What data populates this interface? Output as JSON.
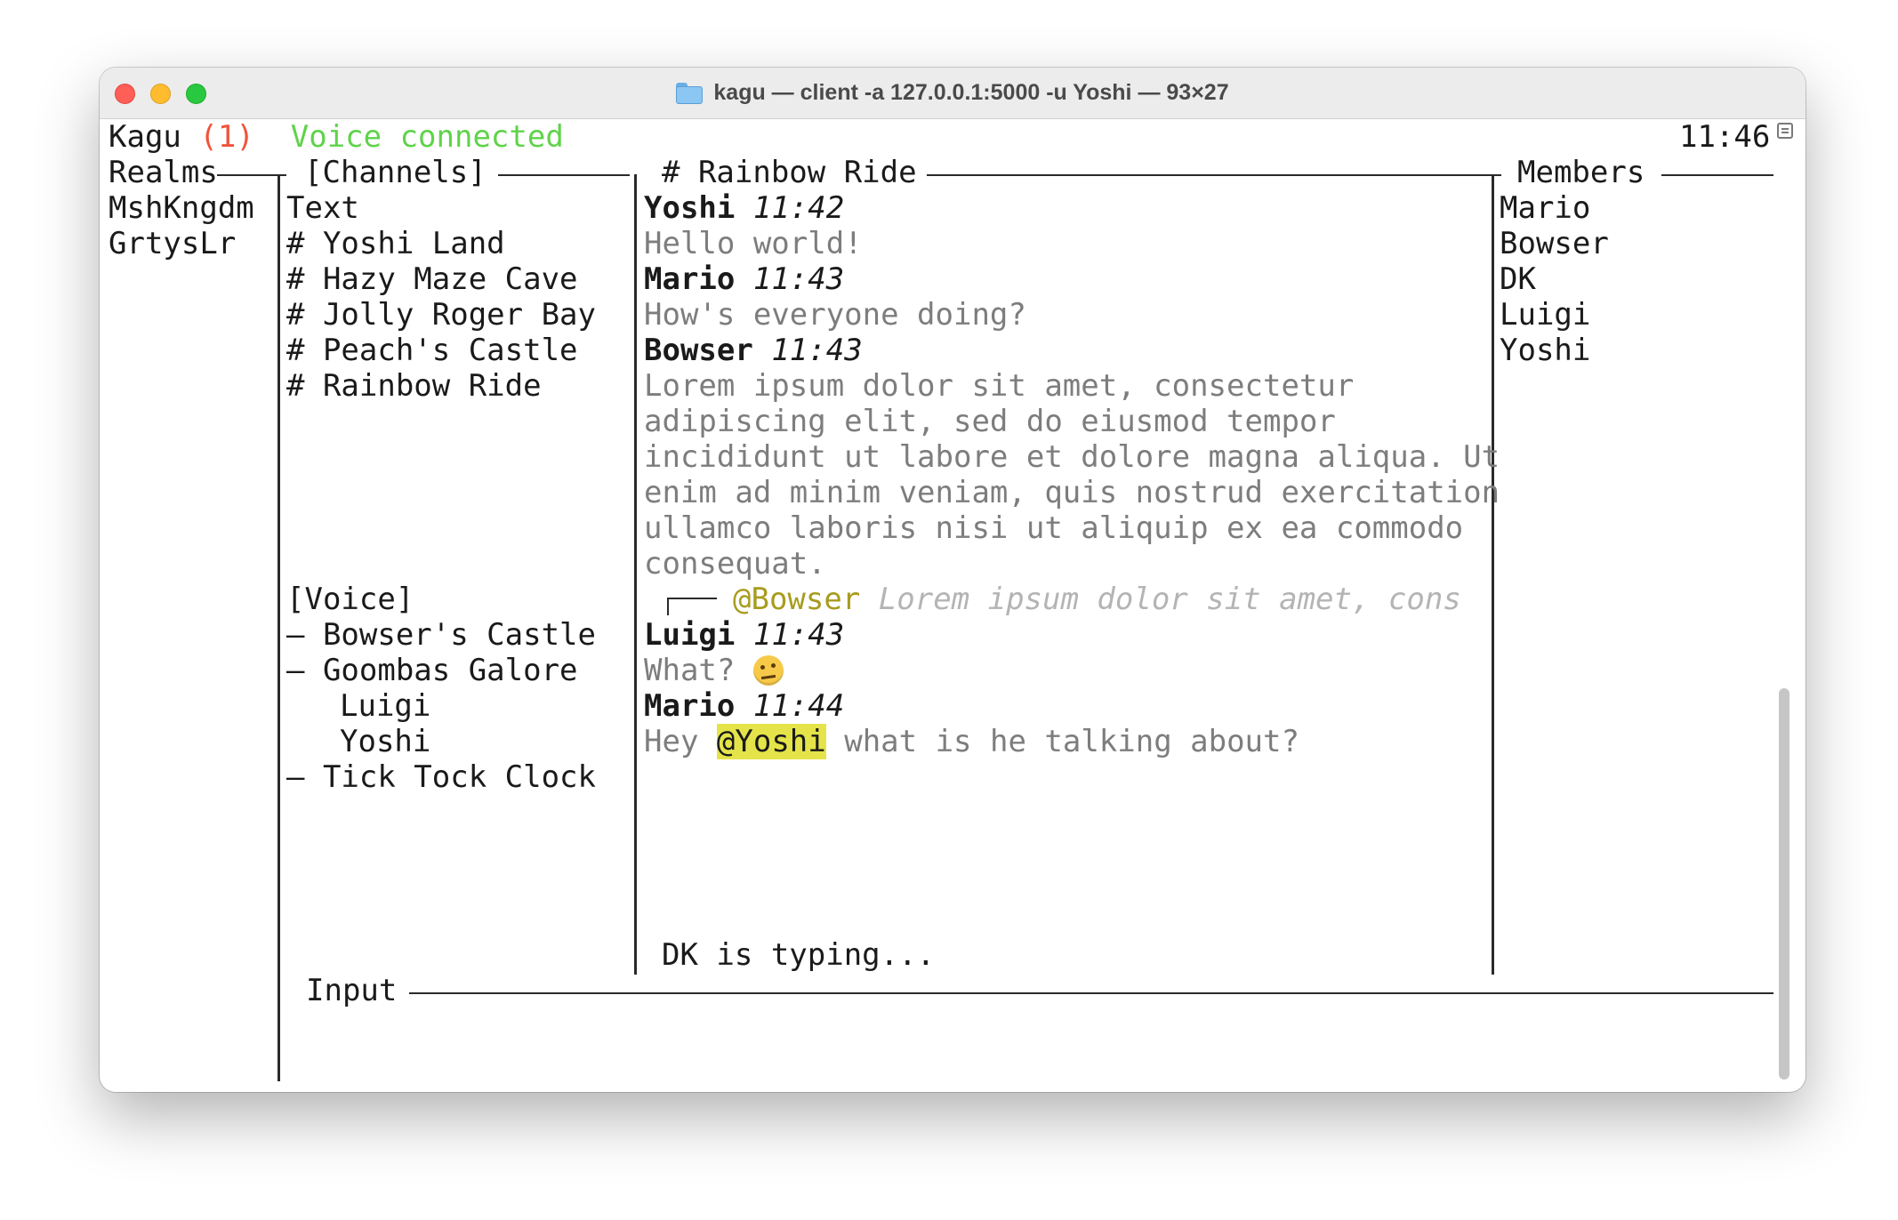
{
  "window": {
    "title": "kagu — client -a 127.0.0.1:5000 -u Yoshi — 93×27"
  },
  "status": {
    "app": "Kagu",
    "unread": "(1)",
    "voice": "Voice connected",
    "time": "11:46"
  },
  "realms": {
    "header": "Realms",
    "items": [
      "MshKngdm",
      "GrtysLr"
    ]
  },
  "channels": {
    "header": "[Channels]",
    "text_header": "Text",
    "text": [
      "# Yoshi Land",
      "# Hazy Maze Cave",
      "# Jolly Roger Bay",
      "# Peach's Castle",
      "# Rainbow Ride"
    ],
    "voice_header": "[Voice]",
    "voice": [
      "– Bowser's Castle",
      "– Goombas Galore",
      "Luigi",
      "Yoshi",
      "– Tick Tock Clock"
    ]
  },
  "chat": {
    "header": "# Rainbow Ride",
    "messages": [
      {
        "author": "Yoshi",
        "time": "11:42",
        "lines": [
          "Hello world!"
        ]
      },
      {
        "author": "Mario",
        "time": "11:43",
        "lines": [
          "How's everyone doing?"
        ]
      },
      {
        "author": "Bowser",
        "time": "11:43",
        "lines": [
          "Lorem ipsum dolor sit amet, consectetur",
          "adipiscing elit, sed do eiusmod tempor",
          "incididunt ut labore et dolore magna aliqua. Ut",
          "enim ad minim veniam, quis nostrud exercitation",
          "ullamco laboris nisi ut aliquip ex ea commodo",
          "consequat."
        ]
      },
      {
        "author": "Luigi",
        "time": "11:43",
        "reply_to": "@Bowser",
        "reply_preview": "Lorem ipsum dolor sit amet, cons",
        "lines": [
          "What?"
        ],
        "emoji": "face-with-raised-eyebrow"
      },
      {
        "author": "Mario",
        "time": "11:44",
        "before": "Hey",
        "mention": "@Yoshi",
        "after": "what is he talking about?"
      }
    ],
    "typing": "DK is typing..."
  },
  "members": {
    "header": "Members",
    "items": [
      "Mario",
      "Bowser",
      "DK",
      "Luigi",
      "Yoshi"
    ]
  },
  "input": {
    "label": "Input",
    "value": ""
  },
  "colors": {
    "unread": "#f0533a",
    "voice_connected": "#5fd34a",
    "reply_mention": "#a89c1e",
    "self_mention_bg": "#e4e44a",
    "message_body": "#7d7d7d"
  }
}
